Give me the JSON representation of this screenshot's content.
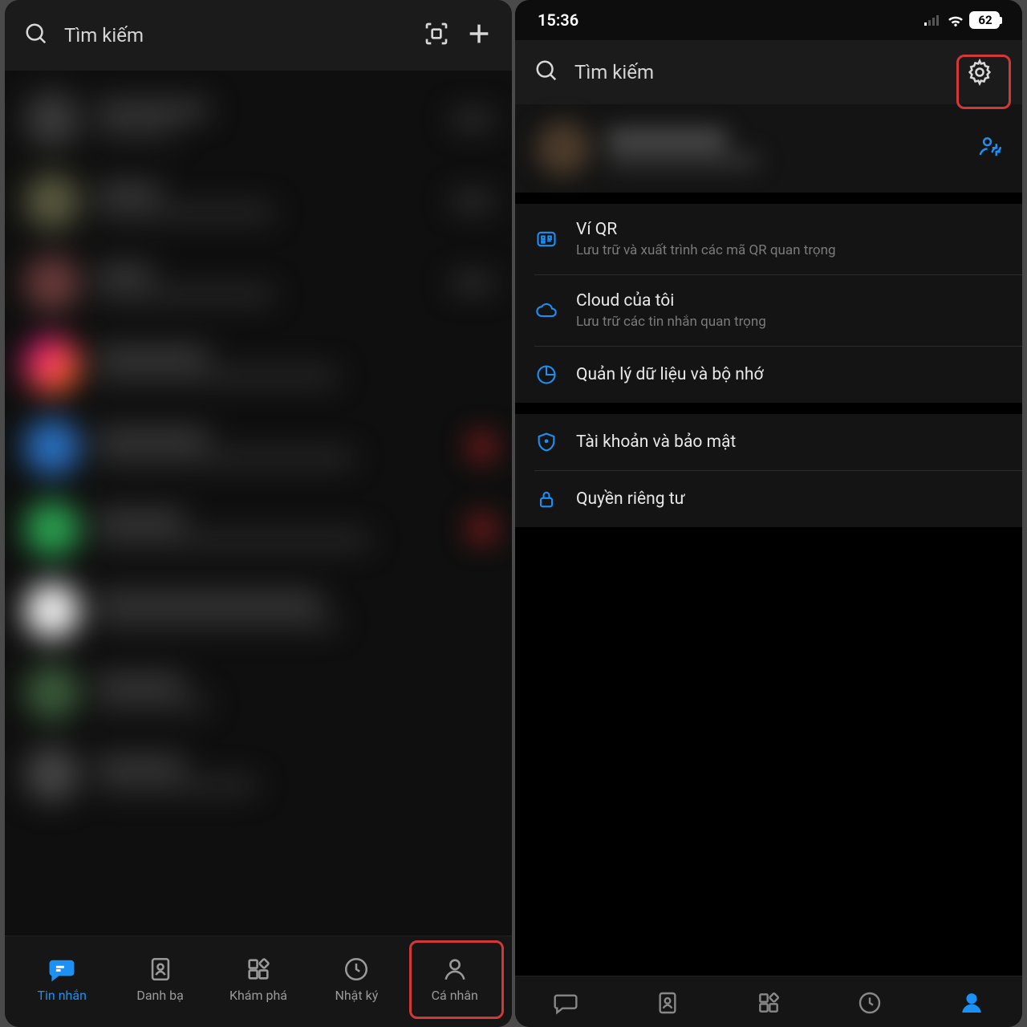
{
  "left": {
    "search_placeholder": "Tìm kiếm",
    "tabs": {
      "messages": "Tin nhắn",
      "contacts": "Danh bạ",
      "discover": "Khám phá",
      "diary": "Nhật ký",
      "me": "Cá nhân"
    },
    "active_tab": "messages",
    "highlighted_tab": "me"
  },
  "right": {
    "status": {
      "time": "15:36",
      "battery": "62"
    },
    "search_placeholder": "Tìm kiếm",
    "menu": {
      "qr": {
        "title": "Ví QR",
        "sub": "Lưu trữ và xuất trình các mã QR quan trọng"
      },
      "cloud": {
        "title": "Cloud của tôi",
        "sub": "Lưu trữ các tin nhắn quan trọng"
      },
      "storage": {
        "title": "Quản lý dữ liệu và bộ nhớ"
      },
      "security": {
        "title": "Tài khoản và bảo mật"
      },
      "privacy": {
        "title": "Quyền riêng tư"
      }
    },
    "active_tab": "me"
  }
}
